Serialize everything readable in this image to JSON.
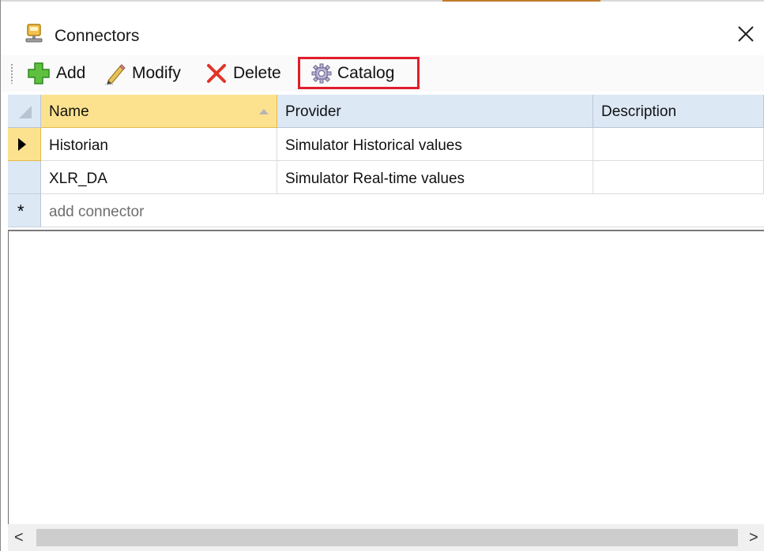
{
  "window": {
    "title": "Connectors",
    "title_icon": "connector-icon",
    "close_icon": "close-icon"
  },
  "toolbar": {
    "add_label": "Add",
    "modify_label": "Modify",
    "delete_label": "Delete",
    "catalog_label": "Catalog",
    "highlighted_button": "Catalog",
    "highlight_color": "#e11d2b"
  },
  "grid": {
    "columns": [
      "Name",
      "Provider",
      "Description"
    ],
    "sorted_column": "Name",
    "sort_direction": "ascending",
    "rows": [
      {
        "name": "Historian",
        "provider": "Simulator Historical values",
        "description": "",
        "current": true
      },
      {
        "name": "XLR_DA",
        "provider": "Simulator Real-time values",
        "description": "",
        "current": false
      }
    ],
    "new_row_placeholder": "add connector",
    "new_row_marker": "*",
    "selected_header_color": "#fce28e",
    "header_color": "#dde8f5"
  },
  "scrollbar": {
    "left_arrow": "<",
    "right_arrow": ">"
  }
}
